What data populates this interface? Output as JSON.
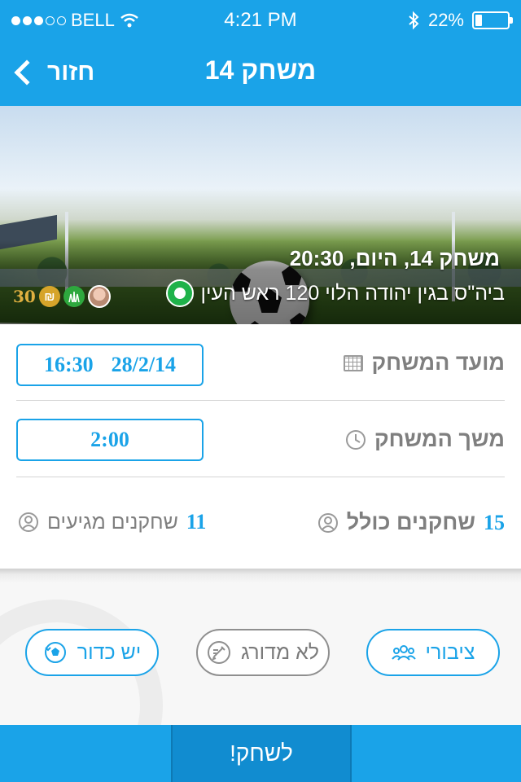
{
  "status_bar": {
    "carrier": "BELL",
    "time": "4:21 PM",
    "battery": "22%",
    "battery_level": 0.22,
    "signal_dots_filled": 3,
    "signal_dots_total": 5
  },
  "nav": {
    "back_label": "חזור",
    "title": "משחק 14"
  },
  "hero": {
    "title_line": "משחק 14, היום, 20:30",
    "location": "ביה\"ס בגין יהודה הלוי 120 ראש העין",
    "price": "30",
    "shekel_symbol": "₪"
  },
  "details": {
    "date_label": "מועד המשחק",
    "date_value": "28/2/14",
    "time_value": "16:30",
    "duration_label": "משך המשחק",
    "duration_value": "2:00",
    "total_players_label": "שחקנים כולל",
    "total_players_value": "15",
    "arriving_players_label": "שחקנים מגיעים",
    "arriving_players_value": "11"
  },
  "options": {
    "public_label": "ציבורי",
    "unranked_label": "לא מדורג",
    "has_ball_label": "יש כדור"
  },
  "bottom": {
    "play_label": "לשחק!"
  },
  "colors": {
    "primary": "#1aa3e8",
    "primary_dark": "#118cd0",
    "grey_text": "#7f7f7f",
    "location_green": "#1fb24a",
    "price_gold": "#e0b040"
  }
}
